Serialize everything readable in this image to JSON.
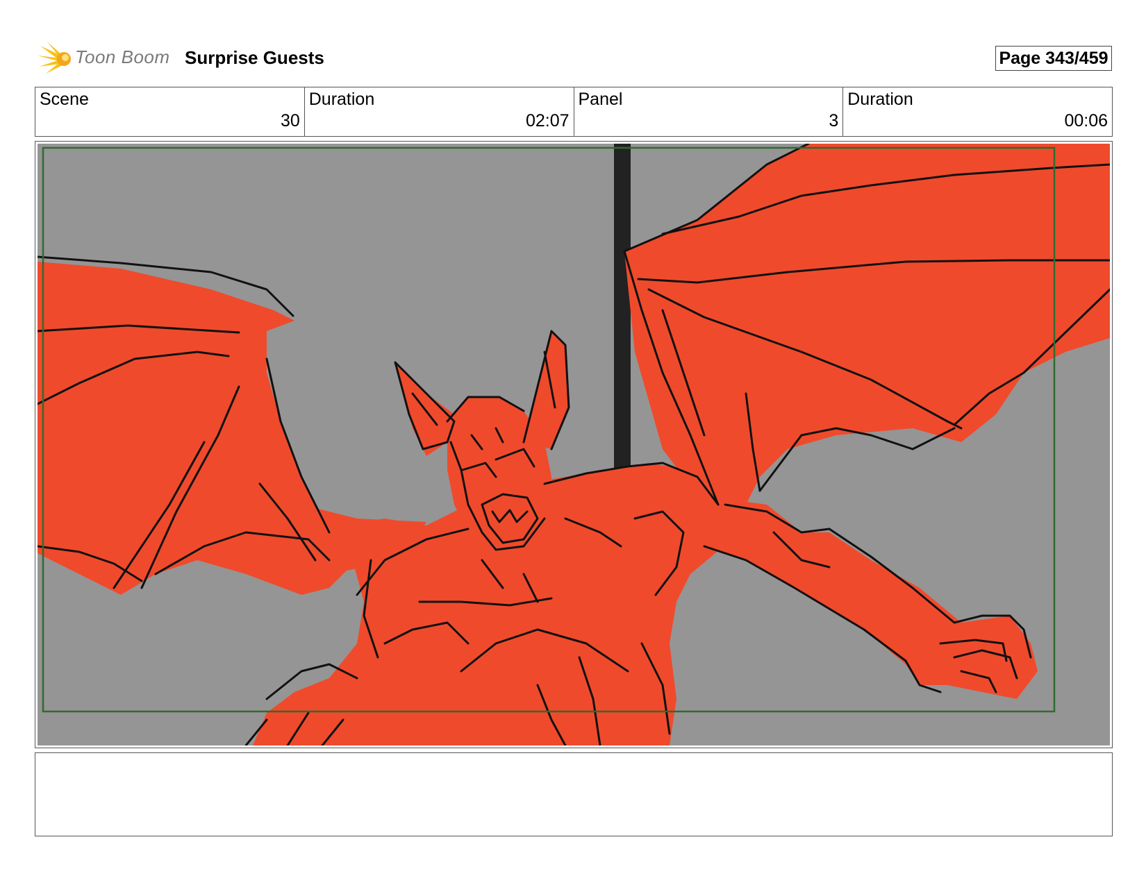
{
  "header": {
    "logo_text": "Toon Boom",
    "project_title": "Surprise Guests",
    "page_label": "Page 343/459"
  },
  "info": [
    {
      "label": "Scene",
      "value": "30"
    },
    {
      "label": "Duration",
      "value": "02:07"
    },
    {
      "label": "Panel",
      "value": "3"
    },
    {
      "label": "Duration",
      "value": "00:06"
    }
  ],
  "panel": {
    "background_color": "#959595",
    "figure_color": "#f04a2c",
    "safe_frame_color": "#2f6b2f",
    "ink_color": "#111111"
  },
  "notes": {
    "text": ""
  }
}
